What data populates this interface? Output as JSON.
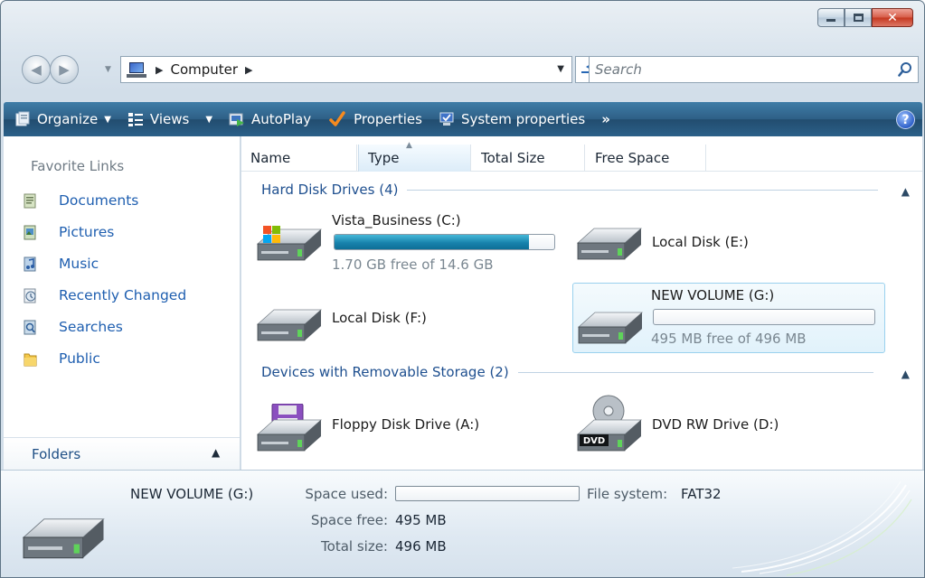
{
  "window": {
    "caption_buttons": [
      "minimize",
      "maximize",
      "close"
    ],
    "close_glyph": "✕"
  },
  "address_bar": {
    "location": "Computer",
    "search_placeholder": "Search"
  },
  "toolbar": {
    "organize": "Organize",
    "views": "Views",
    "autoplay": "AutoPlay",
    "properties": "Properties",
    "system_properties": "System properties",
    "more": "»",
    "help": "?"
  },
  "nav_pane": {
    "favorite_links_title": "Favorite Links",
    "links": [
      "Documents",
      "Pictures",
      "Music",
      "Recently Changed",
      "Searches",
      "Public"
    ],
    "folders_label": "Folders"
  },
  "columns": [
    "Name",
    "Type",
    "Total Size",
    "Free Space"
  ],
  "groups": {
    "hard_disks": {
      "title": "Hard Disk Drives (4)",
      "drives": [
        {
          "name": "Vista_Business (C:)",
          "free_text": "1.70 GB free of 14.6 GB",
          "used_fraction": 0.884
        },
        {
          "name": "Local Disk (E:)"
        },
        {
          "name": "Local Disk (F:)"
        },
        {
          "name": "NEW VOLUME (G:)",
          "free_text": "495 MB free of 496 MB",
          "used_fraction": 0.002,
          "selected": true
        }
      ]
    },
    "removable": {
      "title": "Devices with Removable Storage (2)",
      "drives": [
        {
          "name": "Floppy Disk Drive (A:)"
        },
        {
          "name": "DVD RW Drive (D:)",
          "icon_label": "DVD"
        }
      ]
    }
  },
  "details": {
    "name": "NEW VOLUME (G:)",
    "space_used_label": "Space used:",
    "space_used_fraction": 0.002,
    "file_system_label": "File system:",
    "file_system": "FAT32",
    "space_free_label": "Space free:",
    "space_free": "495 MB",
    "total_size_label": "Total size:",
    "total_size": "496 MB"
  },
  "colors": {
    "toolbar": "#2e5f86",
    "link": "#1f5fb0",
    "capacity_fill": "#1883ad",
    "selection": "#e1f2fb"
  }
}
